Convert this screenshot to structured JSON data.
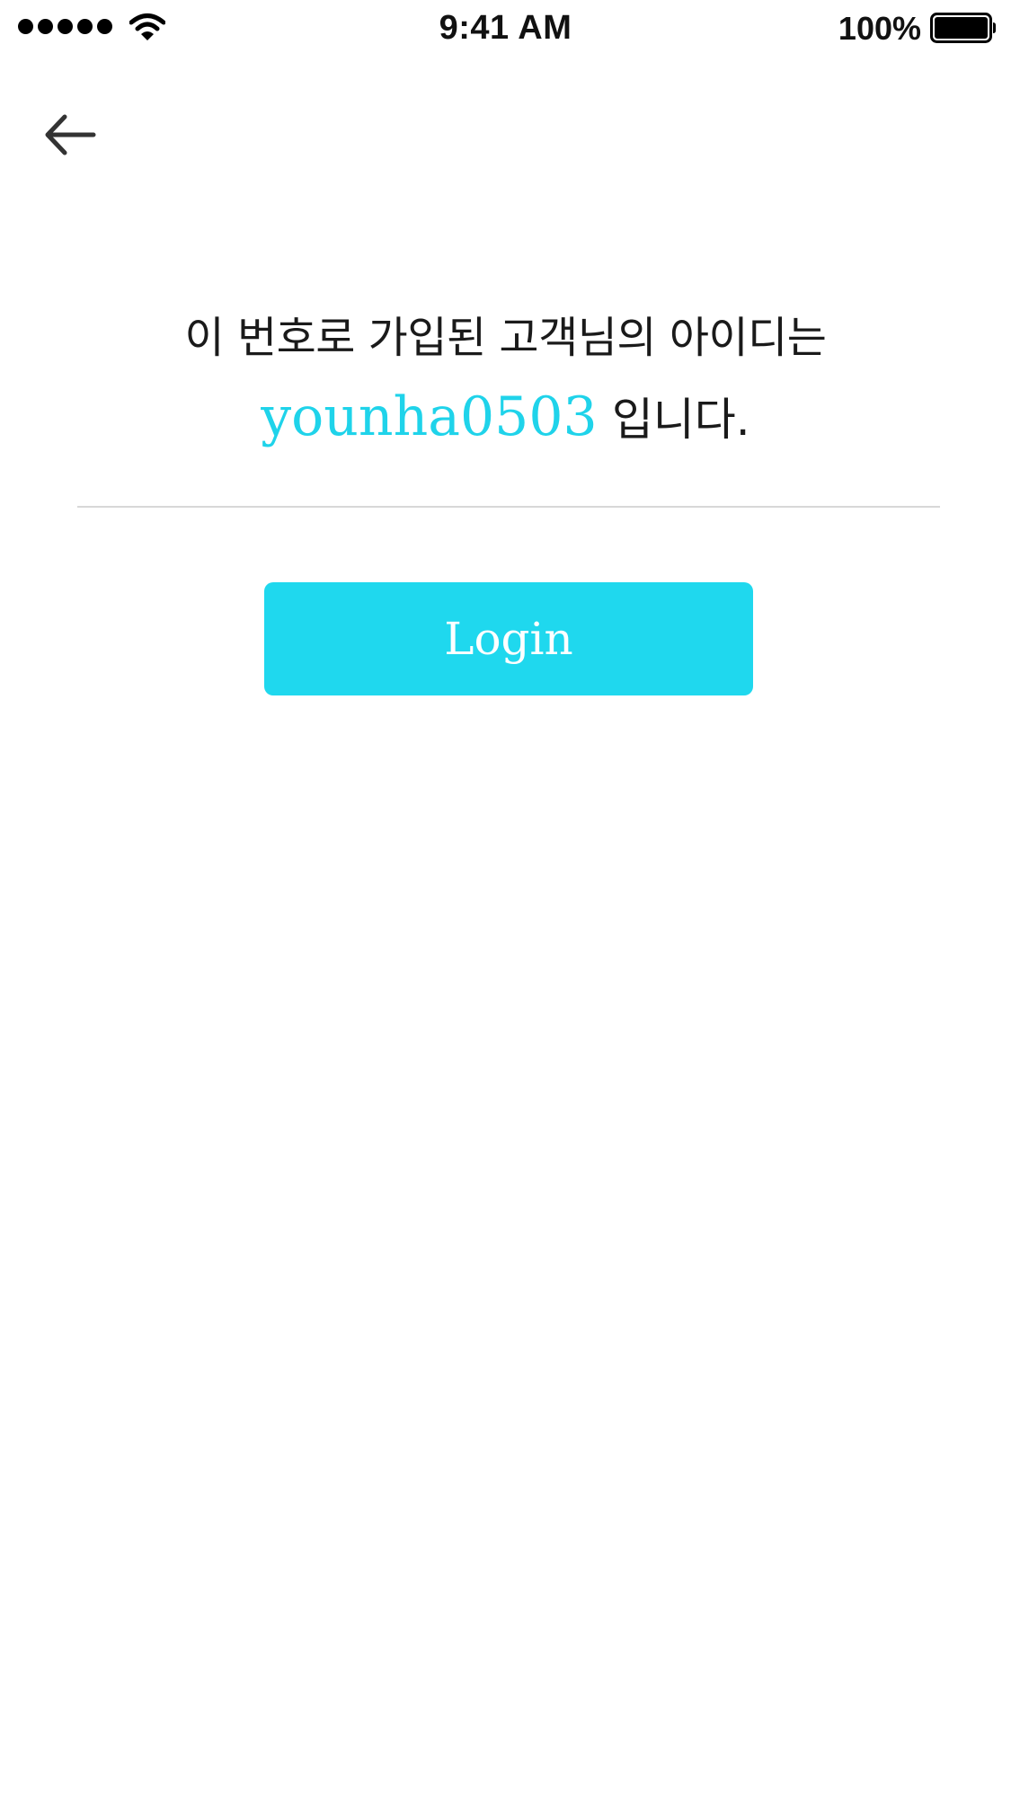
{
  "status_bar": {
    "time": "9:41 AM",
    "battery_percent": "100%",
    "signal_bars": 5,
    "icons": [
      "signal-icon",
      "wifi-icon",
      "battery-icon"
    ]
  },
  "navigation": {
    "back_icon": "arrow-left-icon"
  },
  "message": {
    "line1": "이 번호로 가입된 고객님의 아이디는",
    "user_id": "younha0503",
    "suffix": "입니다."
  },
  "login_button": {
    "label": "Login"
  },
  "colors": {
    "accent": "#1fd8ee",
    "user_id": "#1fd3ea",
    "text": "#1a1a1a",
    "divider": "#d8d8d8"
  }
}
